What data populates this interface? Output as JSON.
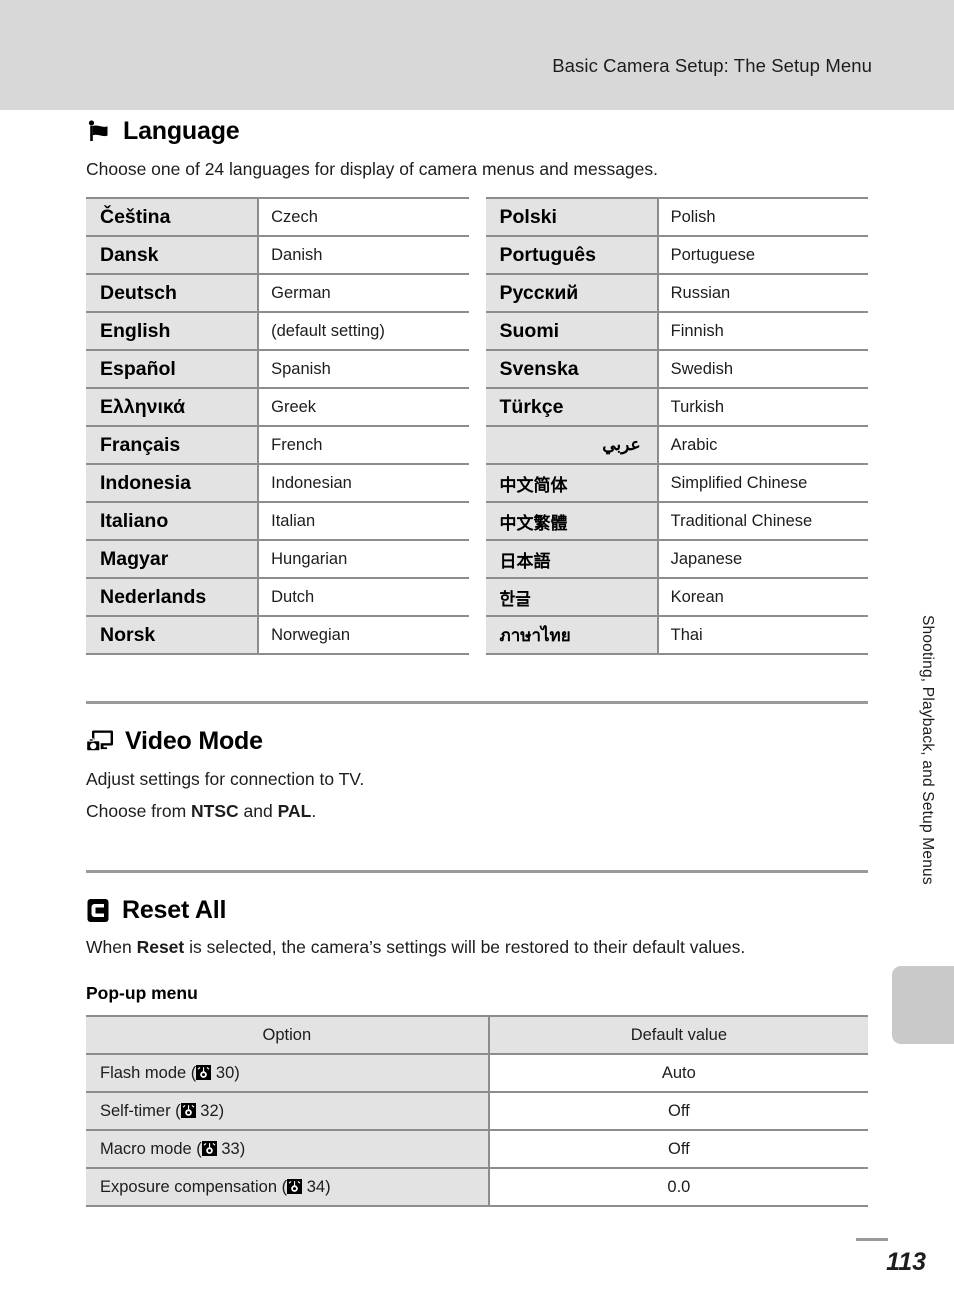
{
  "header": {
    "title": "Basic Camera Setup: The Setup Menu"
  },
  "sections": {
    "language": {
      "icon_name": "flag-icon",
      "title": "Language",
      "description": "Choose one of 24 languages for display of camera menus and messages.",
      "table_left": [
        {
          "native": "Čeština",
          "english": "Czech"
        },
        {
          "native": "Dansk",
          "english": "Danish"
        },
        {
          "native": "Deutsch",
          "english": "German"
        },
        {
          "native": "English",
          "english": "(default setting)"
        },
        {
          "native": "Español",
          "english": "Spanish"
        },
        {
          "native": "Ελληνικά",
          "english": "Greek"
        },
        {
          "native": "Français",
          "english": "French"
        },
        {
          "native": "Indonesia",
          "english": "Indonesian"
        },
        {
          "native": "Italiano",
          "english": "Italian"
        },
        {
          "native": "Magyar",
          "english": "Hungarian"
        },
        {
          "native": "Nederlands",
          "english": "Dutch"
        },
        {
          "native": "Norsk",
          "english": "Norwegian"
        }
      ],
      "table_right": [
        {
          "native": "Polski",
          "english": "Polish"
        },
        {
          "native": "Português",
          "english": "Portuguese"
        },
        {
          "native": "Русский",
          "english": "Russian"
        },
        {
          "native": "Suomi",
          "english": "Finnish"
        },
        {
          "native": "Svenska",
          "english": "Swedish"
        },
        {
          "native": "Türkçe",
          "english": "Turkish"
        },
        {
          "native": "عربي",
          "english": "Arabic"
        },
        {
          "native": "中文简体",
          "english": "Simplified Chinese"
        },
        {
          "native": "中文繁體",
          "english": "Traditional Chinese"
        },
        {
          "native": "日本語",
          "english": "Japanese"
        },
        {
          "native": "한글",
          "english": "Korean"
        },
        {
          "native": "ภาษาไทย",
          "english": "Thai"
        }
      ]
    },
    "video_mode": {
      "icon_name": "tv-camera-icon",
      "title": "Video Mode",
      "line1": "Adjust settings for connection to TV.",
      "line2_prefix": "Choose from ",
      "line2_bold1": "NTSC",
      "line2_mid": " and ",
      "line2_bold2": "PAL",
      "line2_suffix": "."
    },
    "reset_all": {
      "icon_name": "reset-c-icon",
      "title": "Reset All",
      "desc_prefix": "When ",
      "desc_bold": "Reset",
      "desc_suffix": " is selected, the camera’s settings will be restored to their default values.",
      "sub_heading": "Pop-up menu",
      "table": {
        "headers": [
          "Option",
          "Default value"
        ],
        "rows": [
          {
            "option": "Flash mode (",
            "page": "30",
            "option_suffix": ")",
            "value": "Auto"
          },
          {
            "option": "Self-timer (",
            "page": "32",
            "option_suffix": ")",
            "value": "Off"
          },
          {
            "option": "Macro mode (",
            "page": "33",
            "option_suffix": ")",
            "value": "Off"
          },
          {
            "option": "Exposure compensation (",
            "page": "34",
            "option_suffix": ")",
            "value": "0.0"
          }
        ]
      }
    }
  },
  "side": {
    "chapter_label": "Shooting, Playback, and Setup Menus"
  },
  "footer": {
    "page_number": "113"
  },
  "colors": {
    "header_band": "#d8d8d8",
    "table_shade": "#e3e3e3",
    "rule": "#8d8d8d",
    "divider": "#9a9a9a",
    "side_tab": "#c9c9c9"
  }
}
